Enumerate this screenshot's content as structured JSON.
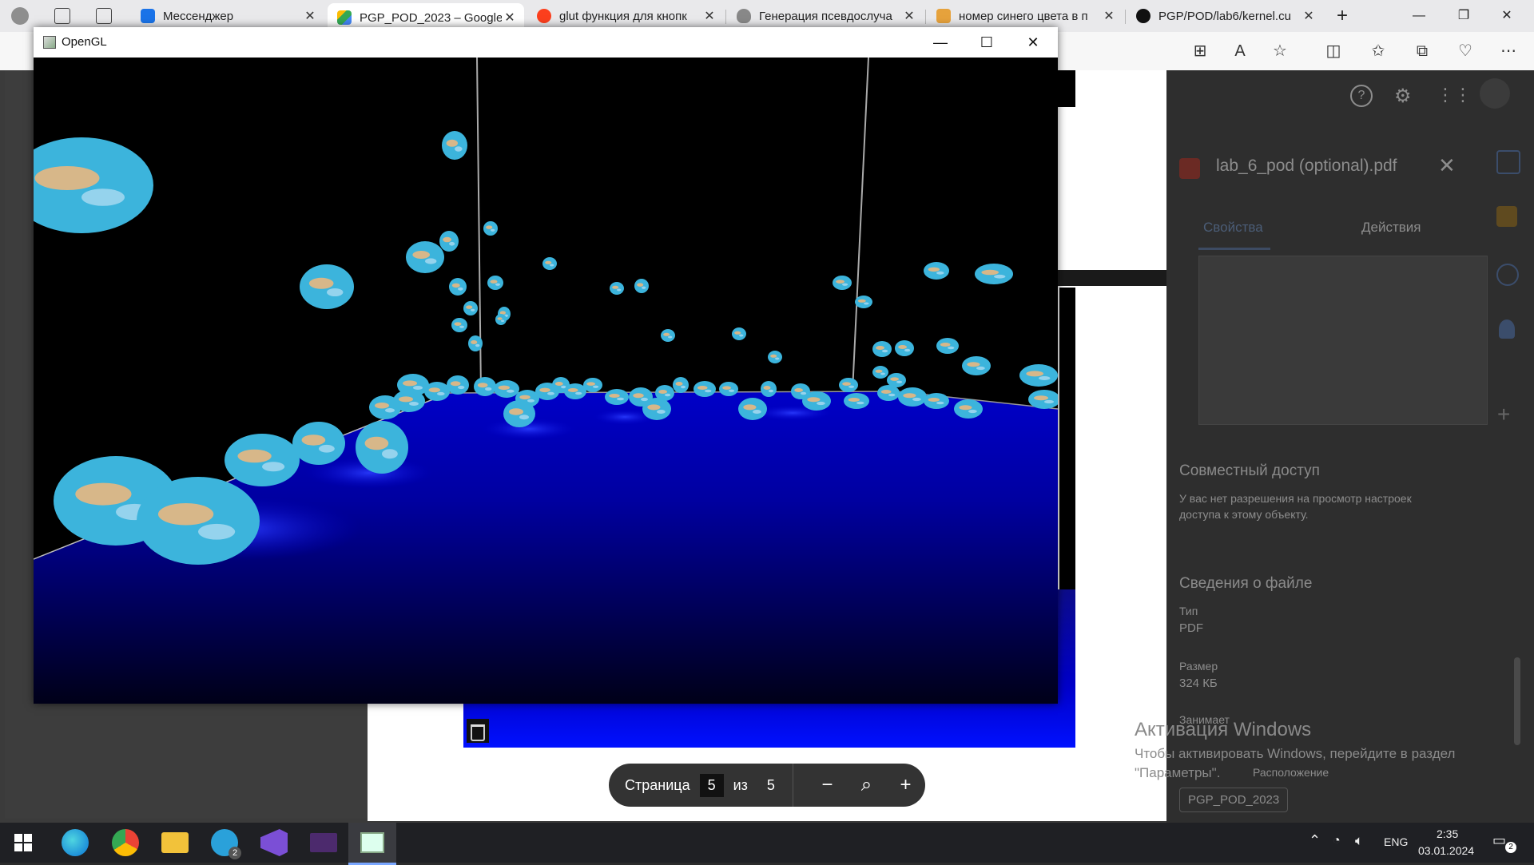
{
  "browser": {
    "tabs": [
      {
        "label": "Мессенджер",
        "icon": "messenger-icon",
        "color": "#1a73e8"
      },
      {
        "label": "PGP_POD_2023 – Google",
        "icon": "google-drive-icon",
        "color": "#34a853",
        "active": true
      },
      {
        "label": "glut функция для кнопк",
        "icon": "yandex-icon",
        "color": "#f33"
      },
      {
        "label": "Генерация псевдослуча",
        "icon": "cloud-icon",
        "color": "#888"
      },
      {
        "label": "номер синего цвета в п",
        "icon": "image-icon",
        "color": "#e6a23c"
      },
      {
        "label": "PGP/POD/lab6/kernel.cu",
        "icon": "github-icon",
        "color": "#111"
      }
    ],
    "new_tab": "+",
    "window_controls": {
      "minimize": "—",
      "maximize": "❐",
      "close": "✕"
    }
  },
  "drive_panel": {
    "filename": "lab_6_pod (optional).pdf",
    "tab_properties": "Свойства",
    "tab_actions": "Действия",
    "sharing_title": "Совместный доступ",
    "sharing_text_1": "У вас нет разрешения на просмотр настроек",
    "sharing_text_2": "доступа к этому объекту.",
    "details_title": "Сведения о файле",
    "type_label": "Тип",
    "type_value": "PDF",
    "size_label": "Размер",
    "size_value": "324 КБ",
    "occupies_label": "Занимает",
    "location_label": "Расположение",
    "folder": "PGP_POD_2023"
  },
  "pager": {
    "page_label": "Страница",
    "current_page": "5",
    "of_label": "из",
    "total_pages": "5"
  },
  "activation": {
    "title": "Активация Windows",
    "line1": "Чтобы активировать Windows, перейдите в раздел",
    "line2": "\"Параметры\"."
  },
  "opengl_window": {
    "title": "OpenGL",
    "controls": {
      "minimize": "—",
      "maximize": "☐",
      "close": "✕"
    }
  },
  "taskbar": {
    "language": "ENG",
    "time": "2:35",
    "date": "03.01.2024",
    "notification_count": "2",
    "telegram_badge": "2"
  }
}
